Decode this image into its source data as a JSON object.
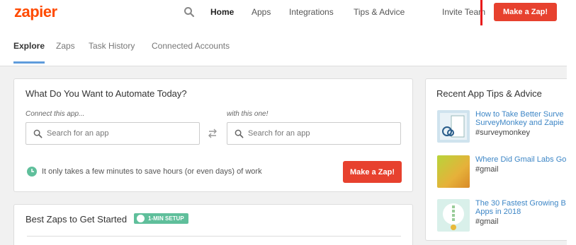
{
  "brand": {
    "logo": "zapier"
  },
  "nav": {
    "items": [
      "Home",
      "Apps",
      "Integrations",
      "Tips & Advice"
    ],
    "invite": "Invite Team",
    "make_zap": "Make a Zap!"
  },
  "subnav": {
    "tabs": [
      "Explore",
      "Zaps",
      "Task History",
      "Connected Accounts"
    ]
  },
  "automate": {
    "title": "What Do You Want to Automate Today?",
    "connect_label": "Connect this app...",
    "with_label": "with this one!",
    "search_placeholder": "Search for an app",
    "tip": "It only takes a few minutes to save hours (or even days) of work",
    "button": "Make a Zap!"
  },
  "best": {
    "title": "Best Zaps to Get Started",
    "badge": "1-MIN SETUP"
  },
  "tips": {
    "title": "Recent App Tips & Advice",
    "items": [
      {
        "line1": "How to Take Better Surve",
        "line2": "SurveyMonkey and Zapie",
        "tag": "#surveymonkey"
      },
      {
        "line1": "Where Did Gmail Labs Go",
        "line2": "",
        "tag": "#gmail"
      },
      {
        "line1": "The 30 Fastest Growing B",
        "line2": "Apps in 2018",
        "tag": "#gmail"
      }
    ]
  },
  "colors": {
    "brand": "#ff4a00",
    "accent_red": "#e7412e",
    "link": "#3d86c6",
    "teal": "#5fbf9b"
  }
}
